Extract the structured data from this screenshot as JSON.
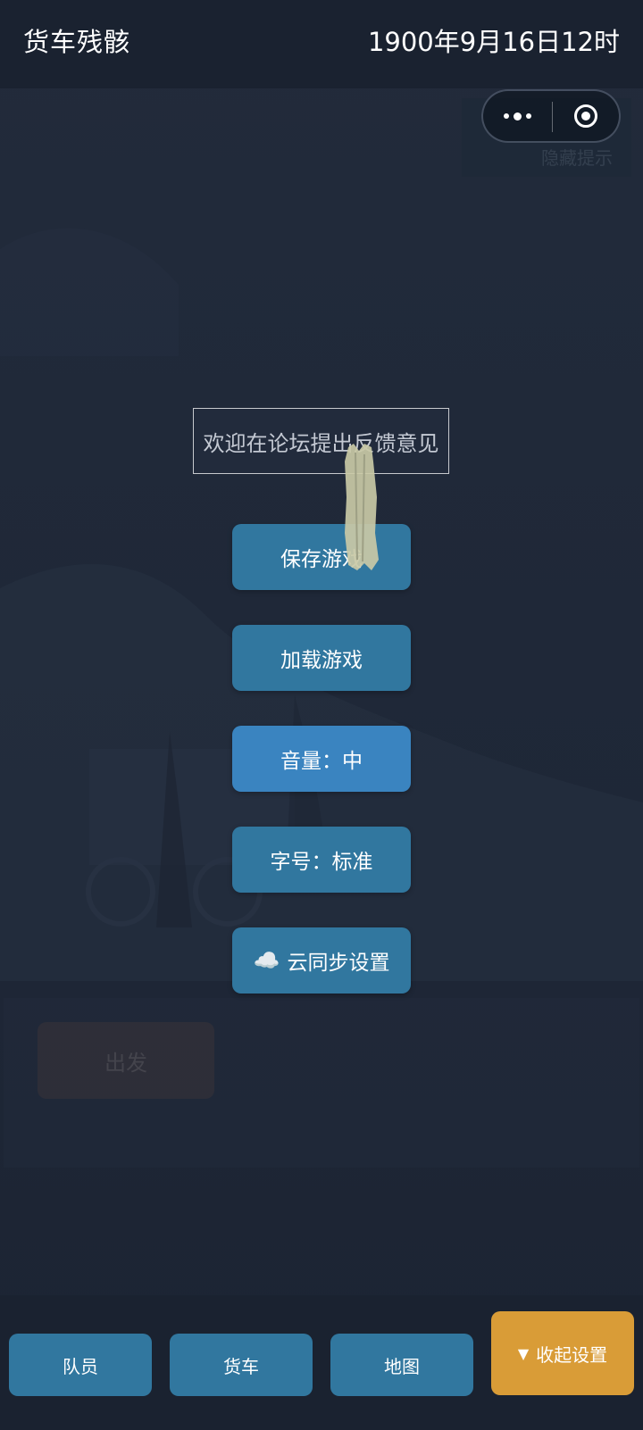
{
  "header": {
    "title": "货车残骸",
    "game_time": "1900年9月16日12时"
  },
  "capsule": {
    "more_icon": "more-dots-icon",
    "close_icon": "target-close-icon"
  },
  "background": {
    "hint_text": "隐藏提示",
    "depart_label": "出发"
  },
  "banner": {
    "text": "欢迎在论坛提出反馈意见"
  },
  "settings_menu": {
    "save_label": "保存游戏",
    "load_label": "加载游戏",
    "volume_label": "音量：中",
    "font_size_label": "字号：标准",
    "cloud_icon_glyph": "☁️",
    "cloud_sync_label": "云同步设置"
  },
  "bottom_nav": {
    "crew_label": "队员",
    "truck_label": "货车",
    "map_label": "地图",
    "collapse_icon": "▼",
    "collapse_label": "收起设置"
  },
  "colors": {
    "primary_button": "#31779f",
    "active_button": "#3a84c0",
    "accent": "#d99c37",
    "bar_background": "#1a2230"
  }
}
